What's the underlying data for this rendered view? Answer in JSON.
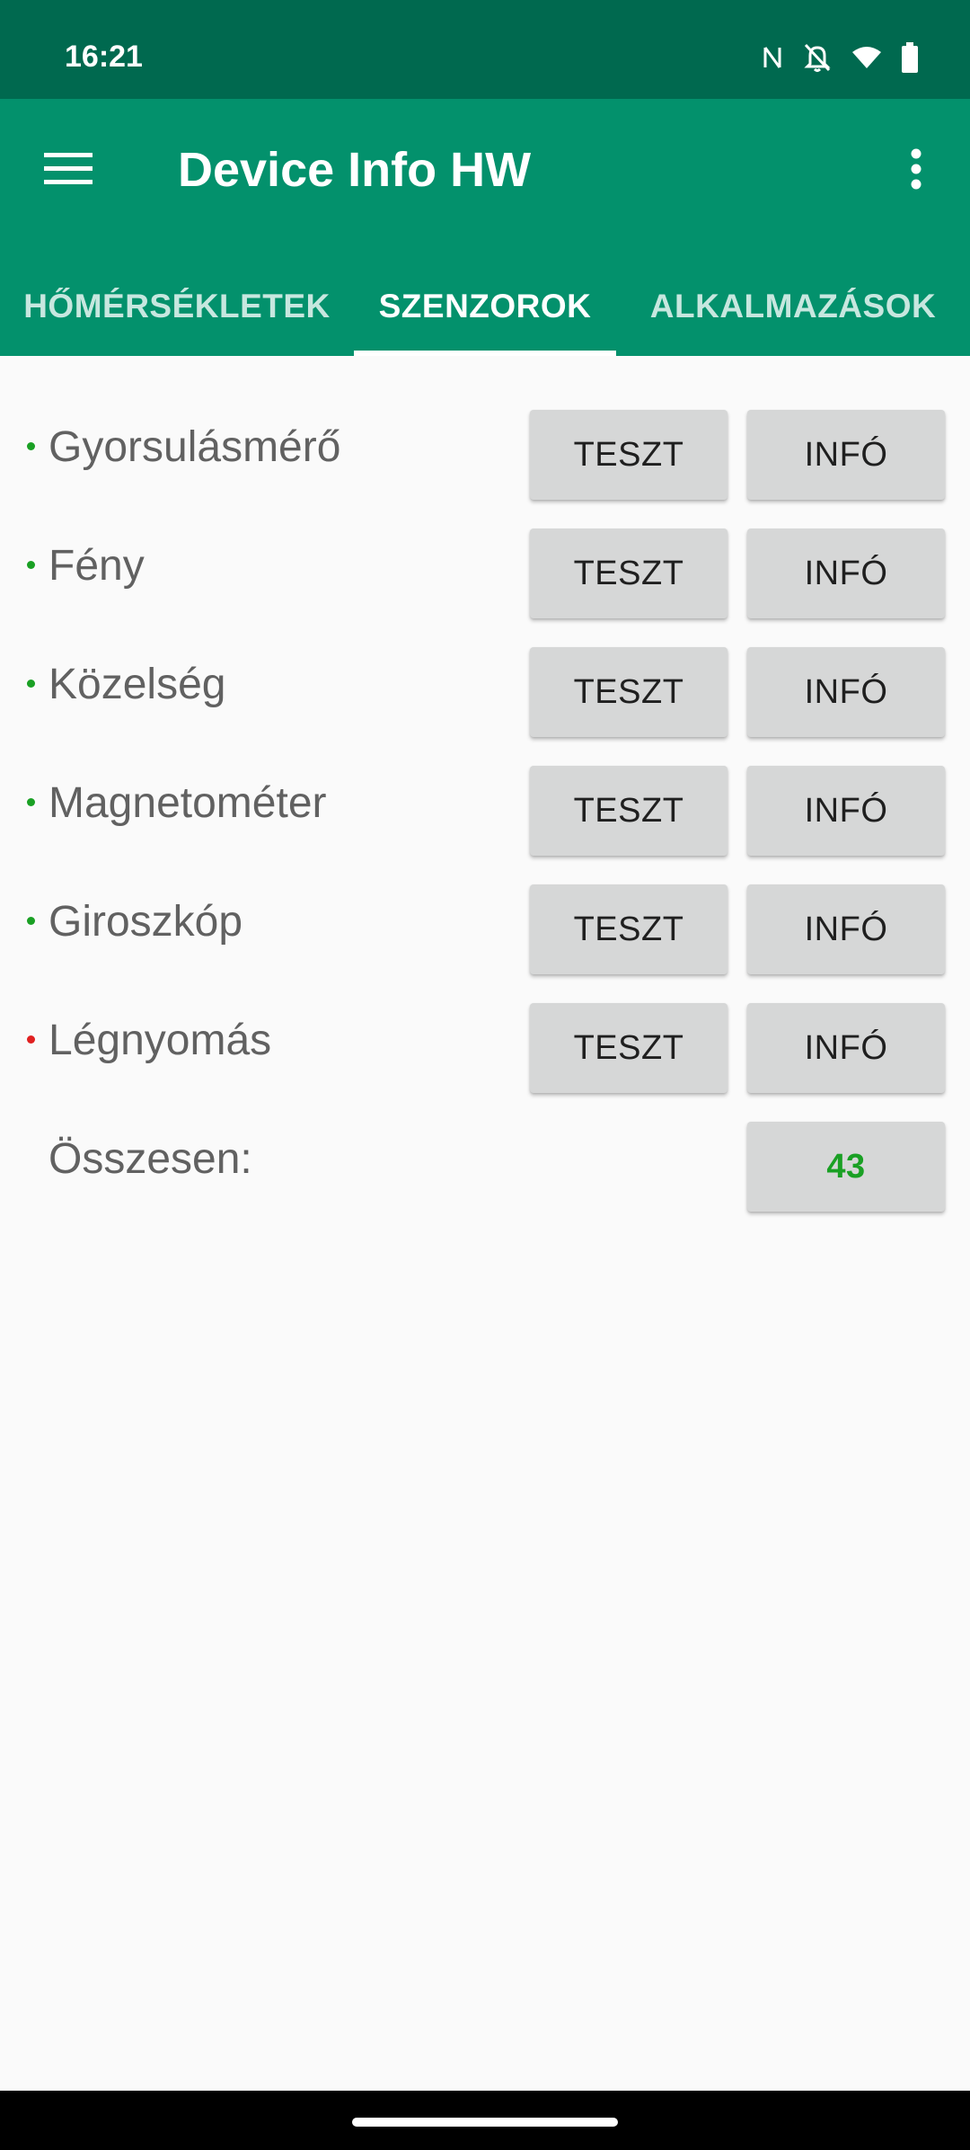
{
  "status_bar": {
    "time": "16:21",
    "icons": [
      "nfc-icon",
      "notifications-off-icon",
      "wifi-icon",
      "battery-icon"
    ]
  },
  "app_bar": {
    "title": "Device Info HW",
    "menu_icon": "hamburger-menu-icon",
    "overflow_icon": "more-vert-icon"
  },
  "tabs": [
    {
      "label": "HŐMÉRSÉKLETEK",
      "active": false
    },
    {
      "label": "SZENZOROK",
      "active": true
    },
    {
      "label": "ALKALMAZÁSOK",
      "active": false
    }
  ],
  "sensors": [
    {
      "label": "Gyorsulásmérő",
      "status_color": "#1aa024",
      "test_label": "TESZT",
      "info_label": "INFÓ"
    },
    {
      "label": "Fény",
      "status_color": "#1aa024",
      "test_label": "TESZT",
      "info_label": "INFÓ"
    },
    {
      "label": "Közelség",
      "status_color": "#1aa024",
      "test_label": "TESZT",
      "info_label": "INFÓ"
    },
    {
      "label": "Magnetométer",
      "status_color": "#1aa024",
      "test_label": "TESZT",
      "info_label": "INFÓ"
    },
    {
      "label": "Giroszkóp",
      "status_color": "#1aa024",
      "test_label": "TESZT",
      "info_label": "INFÓ"
    },
    {
      "label": "Légnyomás",
      "status_color": "#e02020",
      "test_label": "TESZT",
      "info_label": "INFÓ"
    }
  ],
  "total": {
    "label": "Összesen:",
    "value": "43"
  },
  "colors": {
    "status_bar": "#00694f",
    "app_bar": "#03916c",
    "ok": "#1aa024",
    "error": "#e02020"
  }
}
